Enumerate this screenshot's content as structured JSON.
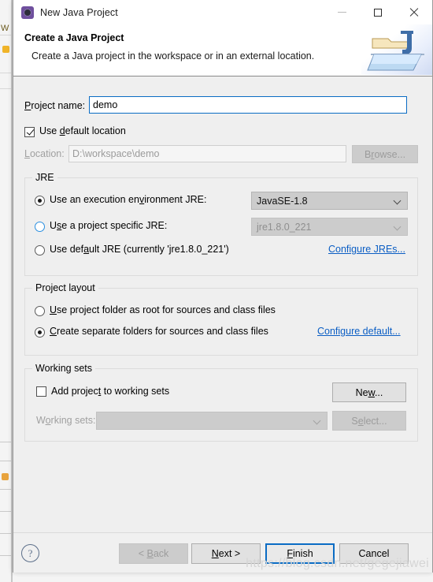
{
  "window": {
    "title": "New Java Project",
    "icon": "eclipse-gear-icon",
    "controls": {
      "minimize": "minimize-icon",
      "maximize": "maximize-icon",
      "close": "close-icon"
    }
  },
  "banner": {
    "title": "Create a Java Project",
    "description": "Create a Java project in the workspace or in an external location.",
    "art": "java-project-folder-icon"
  },
  "form": {
    "project_name_label": "Project name:",
    "project_name_mnemonic": "P",
    "project_name_value": "demo",
    "use_default_location_label": "Use default location",
    "use_default_location_mnemonic": "d",
    "use_default_location_checked": true,
    "location_label": "Location:",
    "location_mnemonic": "L",
    "location_value": "D:\\workspace\\demo",
    "location_enabled": false,
    "browse_label": "Browse...",
    "browse_mnemonic": "r",
    "browse_enabled": false
  },
  "jre": {
    "group_title": "JRE",
    "options": [
      {
        "label": "Use an execution environment JRE:",
        "mnemonic_before": "Use an execution en",
        "mnemonic": "v",
        "mnemonic_after": "ironment JRE:",
        "selected": true,
        "control": "combo",
        "value": "JavaSE-1.8",
        "enabled": true
      },
      {
        "label": "Use a project specific JRE:",
        "mnemonic_before": "U",
        "mnemonic": "s",
        "mnemonic_after": "e a project specific JRE:",
        "selected": false,
        "hover": true,
        "control": "combo",
        "value": "jre1.8.0_221",
        "enabled": false
      },
      {
        "label": "Use default JRE (currently 'jre1.8.0_221')",
        "mnemonic_before": "Use def",
        "mnemonic": "a",
        "mnemonic_after": "ult JRE (currently 'jre1.8.0_221')",
        "selected": false,
        "control": "none"
      }
    ],
    "configure_link": "Configure JREs..."
  },
  "project_layout": {
    "group_title": "Project layout",
    "options": [
      {
        "mnemonic_before": "",
        "mnemonic": "U",
        "mnemonic_after": "se project folder as root for sources and class files",
        "label": "Use project folder as root for sources and class files",
        "selected": false
      },
      {
        "mnemonic_before": "",
        "mnemonic": "C",
        "mnemonic_after": "reate separate folders for sources and class files",
        "label": "Create separate folders for sources and class files",
        "selected": true
      }
    ],
    "configure_link": "Configure default..."
  },
  "working_sets": {
    "group_title": "Working sets",
    "add_label": "Add project to working sets",
    "add_mnemonic_before": "Add projec",
    "add_mnemonic": "t",
    "add_mnemonic_after": " to working sets",
    "add_checked": false,
    "new_label": "New...",
    "new_mnemonic_before": "Ne",
    "new_mnemonic": "w",
    "new_mnemonic_after": "...",
    "sets_label": "Working sets:",
    "sets_mnemonic_before": "W",
    "sets_mnemonic": "o",
    "sets_mnemonic_after": "rking sets:",
    "sets_value": "",
    "sets_enabled": false,
    "select_label": "Select...",
    "select_mnemonic_before": "S",
    "select_mnemonic": "e",
    "select_mnemonic_after": "lect...",
    "select_enabled": false
  },
  "footer": {
    "help_icon": "question-mark-icon",
    "buttons": [
      {
        "label": "< Back",
        "mnemonic_before": "< ",
        "mnemonic": "B",
        "mnemonic_after": "ack",
        "enabled": false,
        "default": false
      },
      {
        "label": "Next >",
        "mnemonic_before": "",
        "mnemonic": "N",
        "mnemonic_after": "ext >",
        "enabled": true,
        "default": false
      },
      {
        "label": "Finish",
        "mnemonic_before": "",
        "mnemonic": "F",
        "mnemonic_after": "inish",
        "enabled": true,
        "default": true
      },
      {
        "label": "Cancel",
        "mnemonic_before": "",
        "mnemonic": "",
        "mnemonic_after": "Cancel",
        "enabled": true,
        "default": false
      }
    ],
    "watermark": "https://blog.csdn.net/gegejiawei"
  },
  "colors": {
    "accent_blue": "#0a6cc4",
    "link_blue": "#0b5ec4",
    "dialog_bg": "#efefef",
    "banner_bg": "#ffffff",
    "disabled_text": "#9b9b9b"
  }
}
